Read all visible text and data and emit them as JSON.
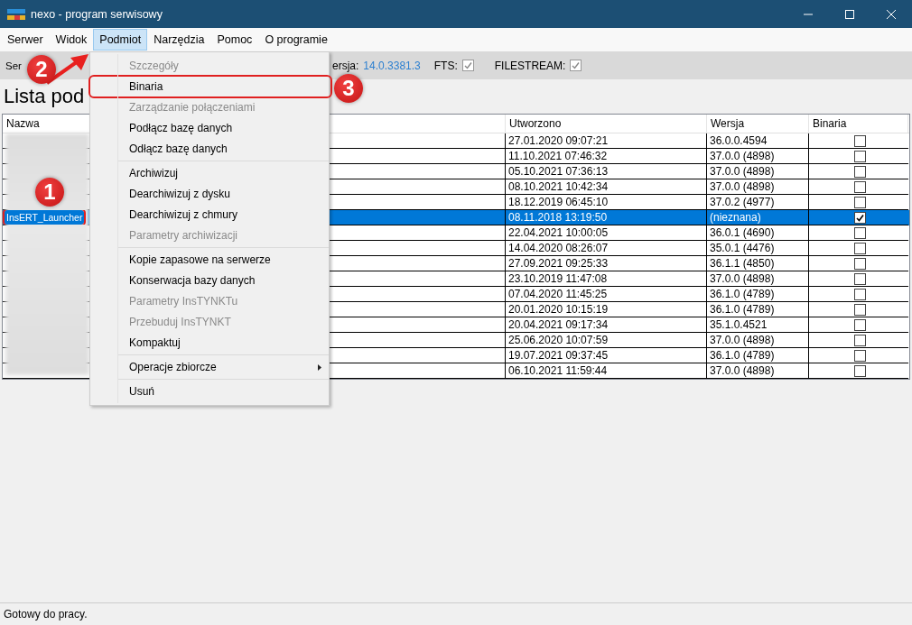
{
  "window": {
    "title": "nexo - program serwisowy"
  },
  "menubar": [
    {
      "label": "Serwer",
      "selected": false
    },
    {
      "label": "Widok",
      "selected": false
    },
    {
      "label": "Podmiot",
      "selected": true
    },
    {
      "label": "Narzędzia",
      "selected": false
    },
    {
      "label": "Pomoc",
      "selected": false
    },
    {
      "label": "O programie",
      "selected": false
    }
  ],
  "info_bar": {
    "server_label": "Ser",
    "version_label": "ersja:",
    "version_value": "14.0.3381.3",
    "checks": [
      {
        "label": "FTS:",
        "checked": true
      },
      {
        "label": "FILESTREAM:",
        "checked": true
      }
    ]
  },
  "heading": "Lista pod",
  "table": {
    "columns": [
      "Nazwa",
      "Utworzono",
      "Wersja",
      "Binaria"
    ],
    "rows": [
      {
        "name": "",
        "created": "27.01.2020 09:07:21",
        "version": "36.0.0.4594",
        "binaries": false,
        "selected": false
      },
      {
        "name": "",
        "created": "11.10.2021 07:46:32",
        "version": "37.0.0 (4898)",
        "binaries": false,
        "selected": false
      },
      {
        "name": "",
        "created": "05.10.2021 07:36:13",
        "version": "37.0.0 (4898)",
        "binaries": false,
        "selected": false
      },
      {
        "name": "",
        "created": "08.10.2021 10:42:34",
        "version": "37.0.0 (4898)",
        "binaries": false,
        "selected": false
      },
      {
        "name": "",
        "created": "18.12.2019 06:45:10",
        "version": "37.0.2 (4977)",
        "binaries": false,
        "selected": false
      },
      {
        "name": "InsERT_Launcher",
        "created": "08.11.2018 13:19:50",
        "version": "(nieznana)",
        "binaries": true,
        "selected": true,
        "outlined": true
      },
      {
        "name": "",
        "created": "22.04.2021 10:00:05",
        "version": "36.0.1 (4690)",
        "binaries": false,
        "selected": false
      },
      {
        "name": "",
        "created": "14.04.2020 08:26:07",
        "version": "35.0.1 (4476)",
        "binaries": false,
        "selected": false
      },
      {
        "name": "",
        "created": "27.09.2021 09:25:33",
        "version": "36.1.1 (4850)",
        "binaries": false,
        "selected": false
      },
      {
        "name": "",
        "created": "23.10.2019 11:47:08",
        "version": "37.0.0 (4898)",
        "binaries": false,
        "selected": false
      },
      {
        "name": "",
        "created": "07.04.2020 11:45:25",
        "version": "36.1.0 (4789)",
        "binaries": false,
        "selected": false
      },
      {
        "name": "",
        "created": "20.01.2020 10:15:19",
        "version": "36.1.0 (4789)",
        "binaries": false,
        "selected": false
      },
      {
        "name": "",
        "created": "20.04.2021 09:17:34",
        "version": "35.1.0.4521",
        "binaries": false,
        "selected": false
      },
      {
        "name": "",
        "created": "25.06.2020 10:07:59",
        "version": "37.0.0 (4898)",
        "binaries": false,
        "selected": false
      },
      {
        "name": "",
        "created": "19.07.2021 09:37:45",
        "version": "36.1.0 (4789)",
        "binaries": false,
        "selected": false
      },
      {
        "name": "",
        "created": "06.10.2021 11:59:44",
        "version": "37.0.0 (4898)",
        "binaries": false,
        "selected": false
      }
    ]
  },
  "dropdown_menu": [
    {
      "kind": "item",
      "label": "Szczegóły",
      "disabled": true
    },
    {
      "kind": "item",
      "label": "Binaria",
      "disabled": false,
      "outlined": true
    },
    {
      "kind": "item",
      "label": "Zarządzanie połączeniami",
      "disabled": true
    },
    {
      "kind": "item",
      "label": "Podłącz bazę danych",
      "disabled": false
    },
    {
      "kind": "item",
      "label": "Odłącz bazę danych",
      "disabled": false
    },
    {
      "kind": "separator"
    },
    {
      "kind": "item",
      "label": "Archiwizuj",
      "disabled": false
    },
    {
      "kind": "item",
      "label": "Dearchiwizuj z dysku",
      "disabled": false
    },
    {
      "kind": "item",
      "label": "Dearchiwizuj z chmury",
      "disabled": false
    },
    {
      "kind": "item",
      "label": "Parametry archiwizacji",
      "disabled": true
    },
    {
      "kind": "separator"
    },
    {
      "kind": "item",
      "label": "Kopie zapasowe na serwerze",
      "disabled": false
    },
    {
      "kind": "item",
      "label": "Konserwacja bazy danych",
      "disabled": false
    },
    {
      "kind": "item",
      "label": "Parametry InsTYNKTu",
      "disabled": true
    },
    {
      "kind": "item",
      "label": "Przebuduj InsTYNKT",
      "disabled": true
    },
    {
      "kind": "item",
      "label": "Kompaktuj",
      "disabled": false
    },
    {
      "kind": "separator"
    },
    {
      "kind": "submenu",
      "label": "Operacje zbiorcze",
      "disabled": false
    },
    {
      "kind": "separator"
    },
    {
      "kind": "item",
      "label": "Usuń",
      "disabled": false
    }
  ],
  "annotations": [
    {
      "label": "1"
    },
    {
      "label": "2"
    },
    {
      "label": "3"
    }
  ],
  "status_bar": "Gotowy do pracy."
}
